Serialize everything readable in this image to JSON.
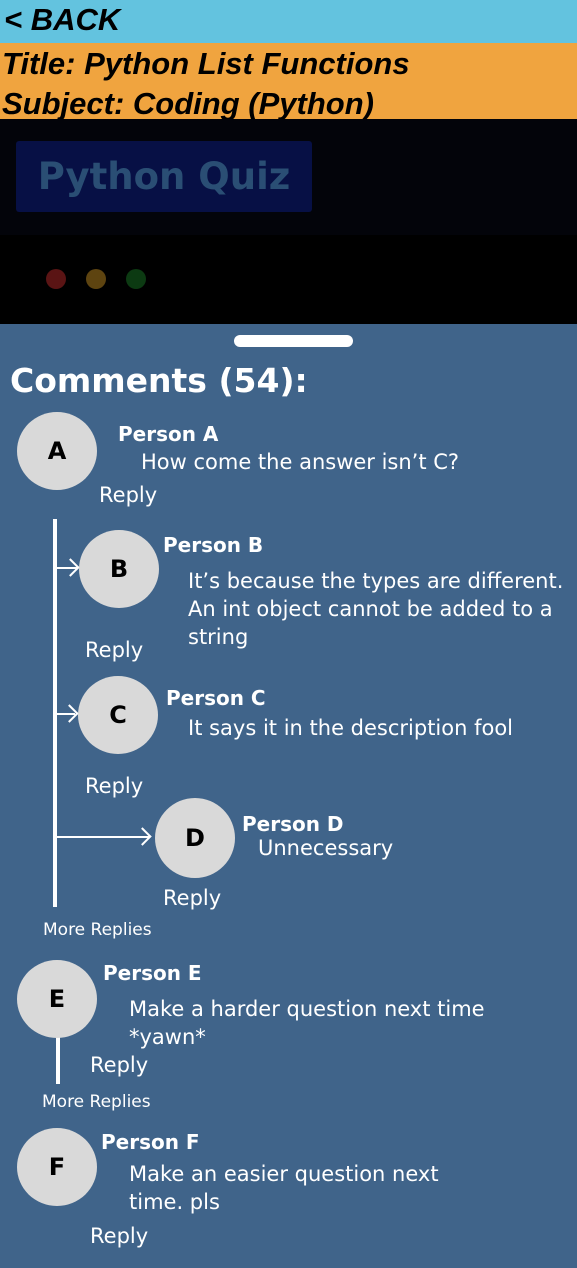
{
  "nav": {
    "back_label": "< BACK"
  },
  "header": {
    "title": "Title: Python List Functions",
    "subject": "Subject: Coding (Python)"
  },
  "video": {
    "quiz_title": "Python Quiz",
    "window_dots": [
      "#e0443e",
      "#dea123",
      "#1aab29"
    ]
  },
  "comments": {
    "heading": "Comments (54):",
    "reply_label": "Reply",
    "more_replies_label": "More Replies",
    "items": [
      {
        "initial": "A",
        "name": "Person A",
        "text": "How come the answer isn’t C?"
      },
      {
        "initial": "B",
        "name": "Person B",
        "text": "It’s because the types are different. An int object cannot be added to a string"
      },
      {
        "initial": "C",
        "name": "Person C",
        "text": "It says it in the description fool"
      },
      {
        "initial": "D",
        "name": "Person D",
        "text": "Unnecessary"
      },
      {
        "initial": "E",
        "name": "Person E",
        "text": "Make a harder question next time *yawn*"
      },
      {
        "initial": "F",
        "name": "Person F",
        "text": "Make an easier question next time. pls"
      }
    ]
  },
  "colors": {
    "back_bar": "#63c3df",
    "title_bar": "#f0a43f",
    "panel": "#40648a",
    "avatar": "#d9d9d9"
  }
}
